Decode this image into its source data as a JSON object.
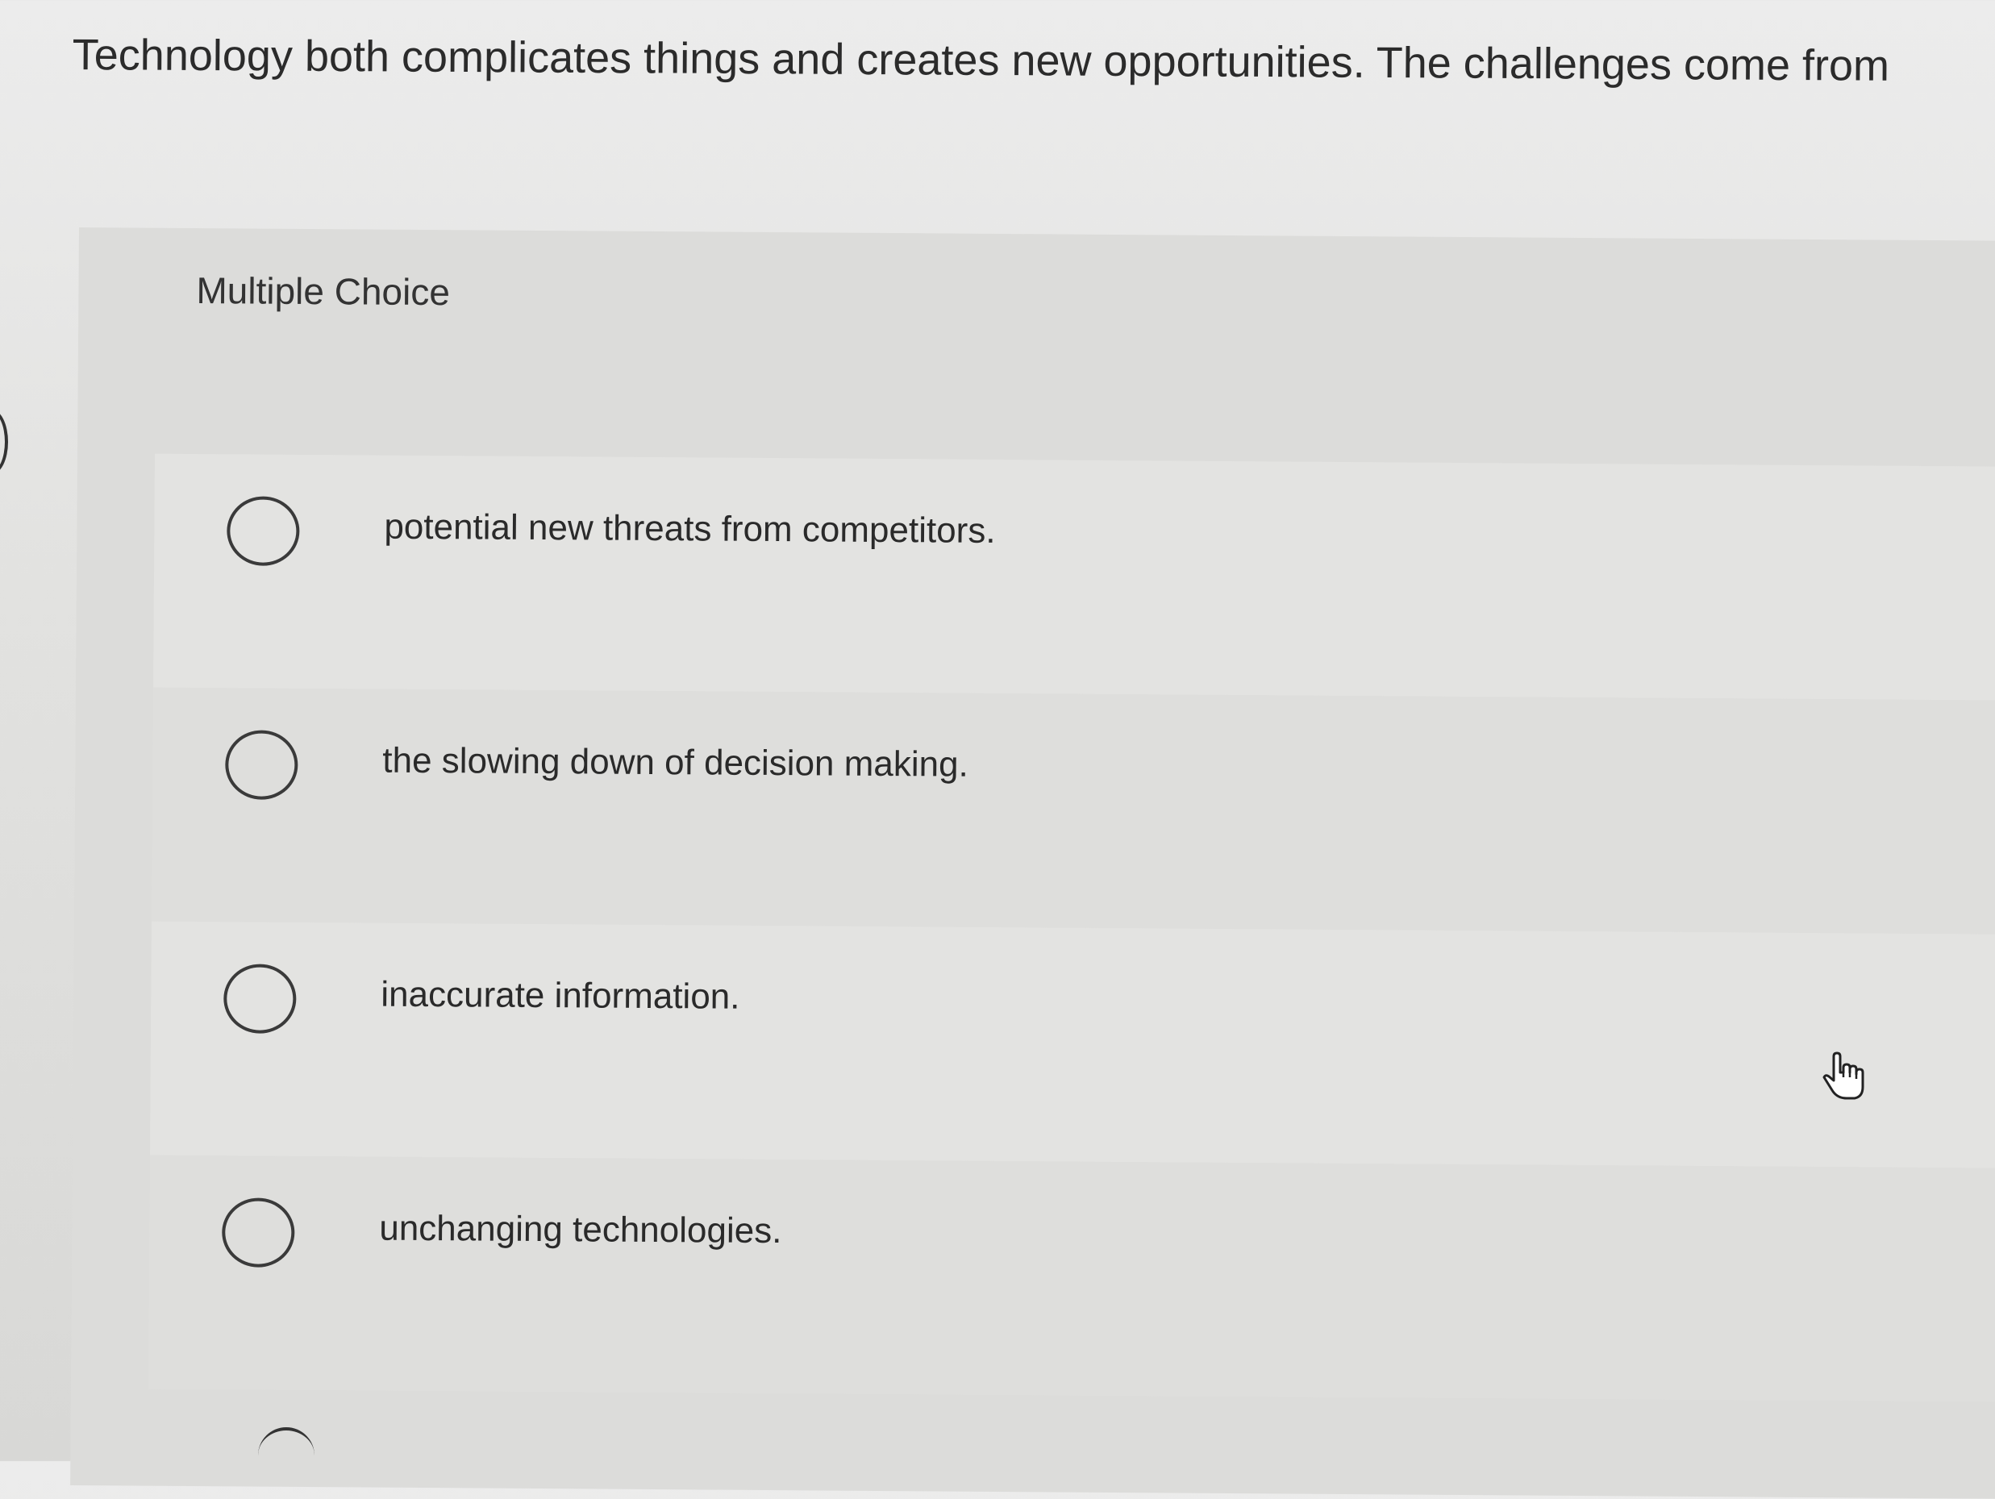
{
  "question": {
    "text": "Technology both complicates things and creates new opportunities. The challenges come from"
  },
  "panel": {
    "heading": "Multiple Choice"
  },
  "choices": [
    {
      "label": "potential new threats from competitors.",
      "selected": false
    },
    {
      "label": "the slowing down of decision making.",
      "selected": false
    },
    {
      "label": "inaccurate information.",
      "selected": false
    },
    {
      "label": "unchanging technologies.",
      "selected": false
    }
  ],
  "icons": {
    "cursor": "hand-pointer-icon",
    "radio": "radio-button-icon"
  }
}
